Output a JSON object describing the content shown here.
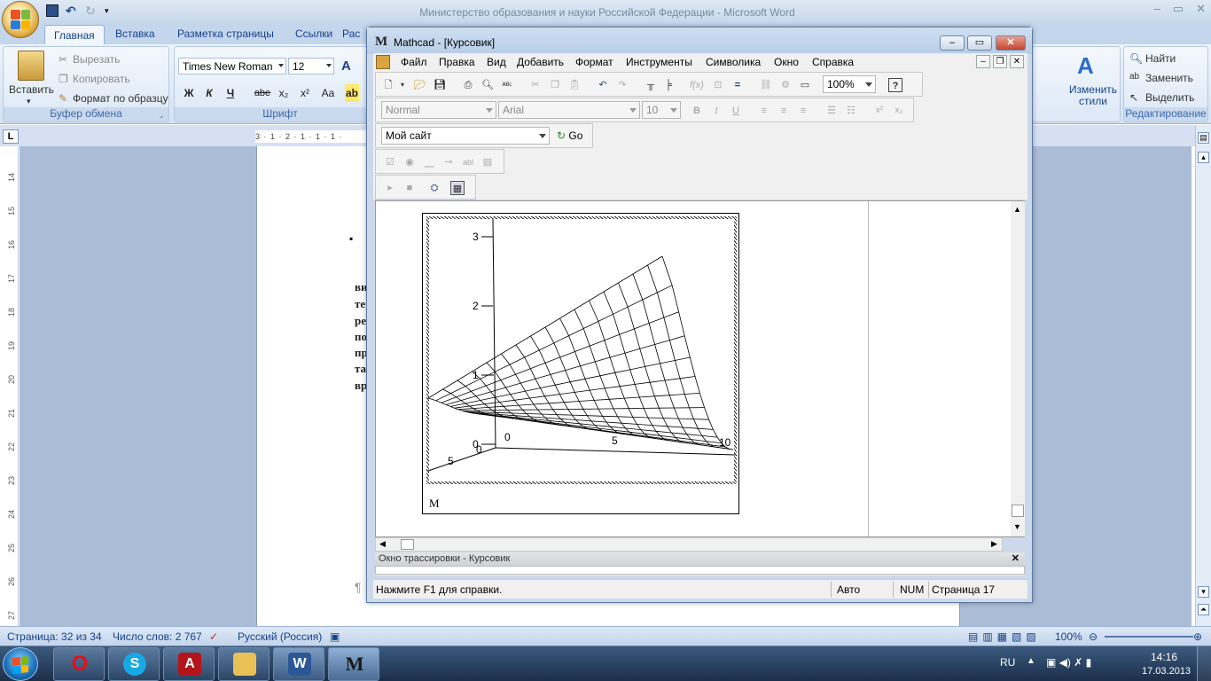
{
  "word": {
    "title": "Министерство образования и науки Российской Федерации - Microsoft Word",
    "tabs": [
      "Главная",
      "Вставка",
      "Разметка страницы",
      "Ссылки",
      "Рас"
    ],
    "clipboard": {
      "paste": "Вставить",
      "cut": "Вырезать",
      "copy": "Копировать",
      "format_painter": "Формат по образцу",
      "group": "Буфер обмена"
    },
    "font": {
      "name": "Times New Roman",
      "size": "12",
      "group": "Шрифт",
      "bold": "Ж",
      "italic": "К",
      "underline": "Ч",
      "strike": "abe",
      "sub": "x₂",
      "sup": "x²",
      "case": "Aa"
    },
    "styles_change": "Изменить стили",
    "editing": {
      "find": "Найти",
      "replace": "Заменить",
      "select": "Выделить",
      "group": "Редактирование"
    },
    "ruler_text": "3 · 1 · 2 · 1 · 1 · 1 ·",
    "vruler_marks": [
      "14",
      "15",
      "16",
      "17",
      "18",
      "19",
      "20",
      "21",
      "22",
      "23",
      "24",
      "25",
      "26",
      "27"
    ],
    "doc_lines": [
      "ви",
      "те",
      "ре",
      "по",
      "пр",
      "та",
      "вр"
    ],
    "para_mark": "¶",
    "status": {
      "page": "Страница: 32 из 34",
      "words": "Число слов: 2 767",
      "language": "Русский (Россия)",
      "zoom": "100%"
    }
  },
  "mathcad": {
    "title": "Mathcad - [Курсовик]",
    "menu": [
      "Файл",
      "Правка",
      "Вид",
      "Добавить",
      "Формат",
      "Инструменты",
      "Символика",
      "Окно",
      "Справка"
    ],
    "zoom": "100%",
    "style": "Normal",
    "font": "Arial",
    "font_size": "10",
    "site": "Мой сайт",
    "go": "Go",
    "plot": {
      "z_ticks": [
        "3",
        "2",
        "1",
        "0"
      ],
      "x_ticks": [
        "0",
        "5",
        "10"
      ],
      "y_ticks": [
        "0",
        "5"
      ],
      "name": "M"
    },
    "trace_title": "Окно трассировки - Курсовик",
    "status": {
      "help": "Нажмите F1 для справки.",
      "mode": "Авто",
      "num": "NUM",
      "page": "Страница 17"
    }
  },
  "taskbar": {
    "lang": "RU",
    "time": "14:16",
    "date": "17.03.2013"
  }
}
